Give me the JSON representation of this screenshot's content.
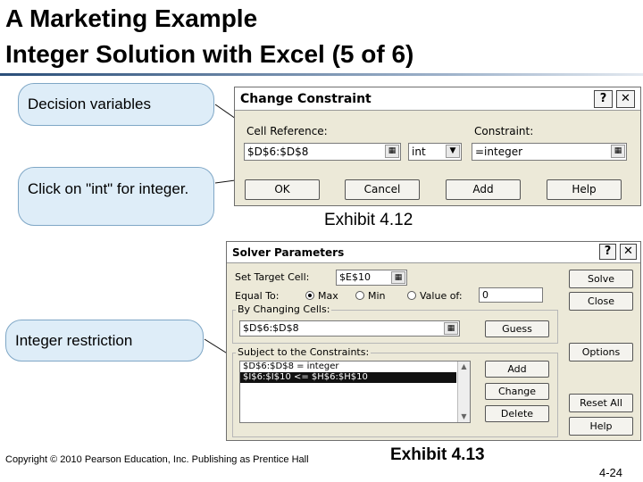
{
  "slide": {
    "title_line1": "A Marketing Example",
    "title_line2": "Integer Solution with Excel (5 of 6)",
    "exhibit_top": "Exhibit 4.12",
    "exhibit_bottom": "Exhibit 4.13",
    "copyright": "Copyright © 2010 Pearson Education, Inc. Publishing as Prentice Hall",
    "page_number": "4-24"
  },
  "callouts": {
    "decision_variables": "Decision variables",
    "click_int": "Click on \"int\" for integer.",
    "integer_restriction": "Integer restriction"
  },
  "change_constraint": {
    "title": "Change Constraint",
    "help_glyph": "?",
    "close_glyph": "✕",
    "cell_reference_label": "Cell Reference:",
    "cell_reference_value": "$D$6:$D$8",
    "operator_value": "int",
    "constraint_label": "Constraint:",
    "constraint_value": "=integer",
    "buttons": {
      "ok": "OK",
      "cancel": "Cancel",
      "add": "Add",
      "help": "Help"
    }
  },
  "solver_parameters": {
    "title": "Solver Parameters",
    "help_glyph": "?",
    "close_glyph": "✕",
    "target_cell_label": "Set Target Cell:",
    "target_cell_value": "$E$10",
    "equal_to_label": "Equal To:",
    "radio_max": "Max",
    "radio_min": "Min",
    "radio_value_of": "Value of:",
    "value_of_value": "0",
    "changing_cells_label": "By Changing Cells:",
    "changing_cells_value": "$D$6:$D$8",
    "constraints_label": "Subject to the Constraints:",
    "constraints": [
      "$D$6:$D$8 = integer",
      "$I$6:$I$10 <= $H$6:$H$10"
    ],
    "buttons": {
      "solve": "Solve",
      "close": "Close",
      "guess": "Guess",
      "options": "Options",
      "add": "Add",
      "change": "Change",
      "delete": "Delete",
      "reset_all": "Reset All",
      "help": "Help"
    }
  },
  "colors": {
    "callout_fill": "#deedf8",
    "callout_border": "#7fa7c6",
    "title_rule": "#2a4e79",
    "dialog_face": "#ece9d8"
  }
}
